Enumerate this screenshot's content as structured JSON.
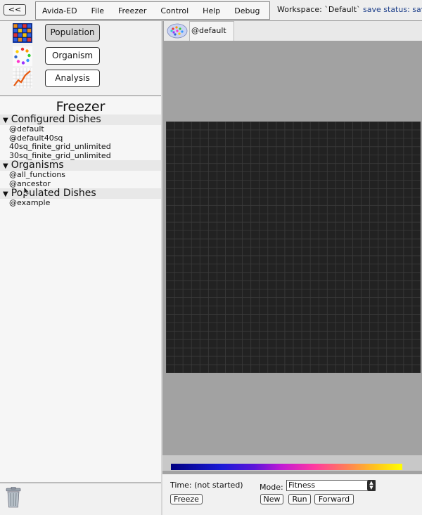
{
  "menubar": {
    "collapse_label": "<<",
    "items": [
      "Avida-ED",
      "File",
      "Freezer",
      "Control",
      "Help",
      "Debug"
    ],
    "workspace_label": "Workspace: `Default`",
    "save_status": "save status: save"
  },
  "nav": {
    "population_label": "Population",
    "organism_label": "Organism",
    "analysis_label": "Analysis",
    "active": "Population"
  },
  "freezer": {
    "title": "Freezer",
    "sections": [
      {
        "label": "Configured Dishes",
        "items": [
          "@default",
          "@default40sq",
          "40sq_finite_grid_unlimited",
          "30sq_finite_grid_unlimited"
        ]
      },
      {
        "label": "Organisms",
        "items": [
          "@all_functions",
          "@ancestor"
        ]
      },
      {
        "label": "Populated Dishes",
        "items": [
          "@example"
        ]
      }
    ]
  },
  "population": {
    "tab_label": "@default",
    "grid": {
      "cols": 30,
      "rows": 30,
      "cell_color": "#222222",
      "line_color": "#3b3b3b"
    }
  },
  "controls": {
    "time_label": "Time: (not started)",
    "mode_label": "Mode:",
    "mode_value": "Fitness",
    "freeze_label": "Freeze",
    "new_label": "New",
    "run_label": "Run",
    "forward_label": "Forward"
  }
}
